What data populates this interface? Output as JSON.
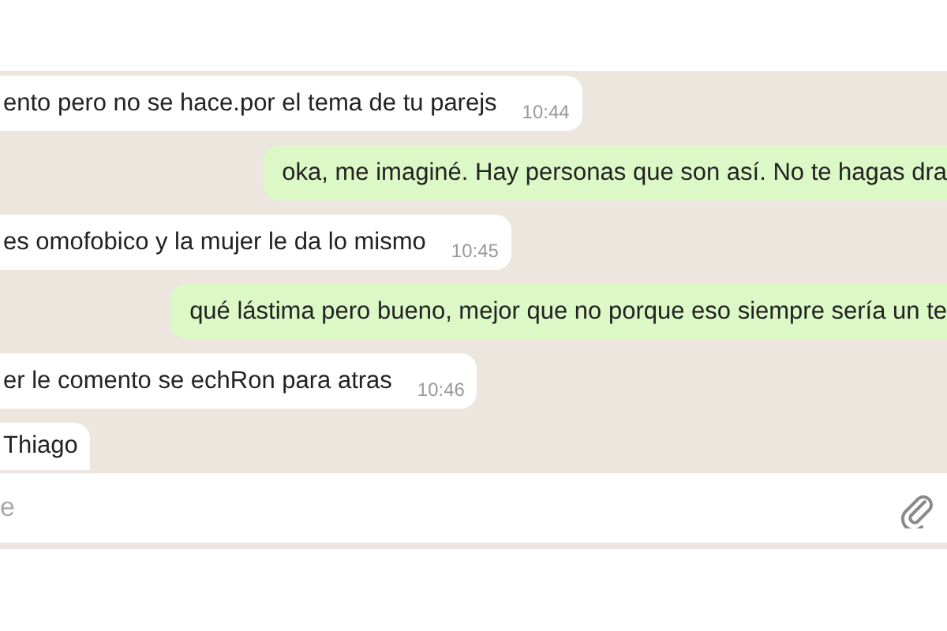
{
  "messages": [
    {
      "kind": "in",
      "text": "ento pero no se hace.por el tema de tu parejs",
      "time": "10:44"
    },
    {
      "kind": "out",
      "text": "oka, me imaginé. Hay personas que son así. No te hagas dra"
    },
    {
      "kind": "in",
      "text": "es omofobico y la mujer le da lo mismo",
      "time": "10:45"
    },
    {
      "kind": "out",
      "text": "qué lástima pero bueno, mejor que no porque eso siempre sería un te"
    },
    {
      "kind": "in",
      "text": "er le comento se echRon para atras",
      "time": "10:46"
    },
    {
      "kind": "in",
      "text": "Thiago"
    }
  ],
  "composer": {
    "placeholder": "e"
  }
}
